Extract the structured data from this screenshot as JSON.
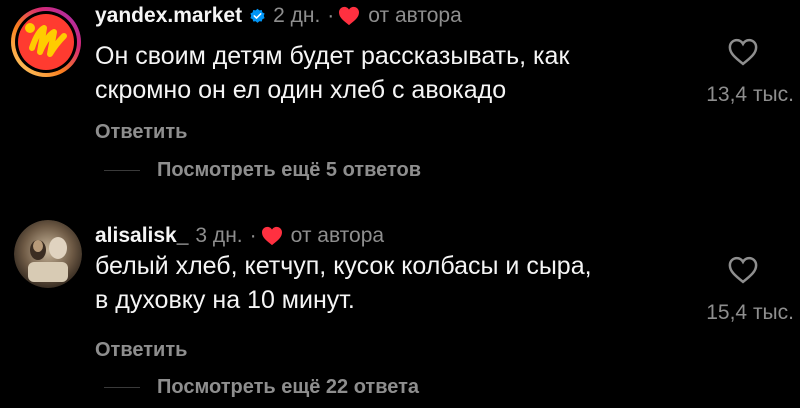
{
  "colors": {
    "background": "#000000",
    "text_primary": "#f5f5f5",
    "text_secondary": "#8e8e8e",
    "heart_red": "#ff3040",
    "verified_blue": "#0095f6",
    "yandex_yellow": "#ffcc00",
    "yandex_red": "#ff3b30"
  },
  "comments": [
    {
      "username": "yandex.market",
      "verified": true,
      "time": "2 дн.",
      "separator": "·",
      "author_note": "от автора",
      "text_line1": "Он своим детям будет рассказывать, как",
      "text_line2": "скромно он ел один хлеб с авокадо",
      "likes": "13,4 тыс.",
      "reply_label": "Ответить",
      "view_replies_label": "Посмотреть ещё 5 ответов",
      "avatar_icon": "yandex-market-logo-icon"
    },
    {
      "username": "alisalisk_",
      "verified": false,
      "time": "3 дн.",
      "separator": "·",
      "author_note": "от автора",
      "text_line1": "белый хлеб, кетчуп, кусок колбасы и сыра,",
      "text_line2": "в духовку на 10 минут.",
      "likes": "15,4 тыс.",
      "reply_label": "Ответить",
      "view_replies_label": "Посмотреть ещё 22 ответа",
      "avatar_icon": "user-photo-avatar"
    }
  ]
}
